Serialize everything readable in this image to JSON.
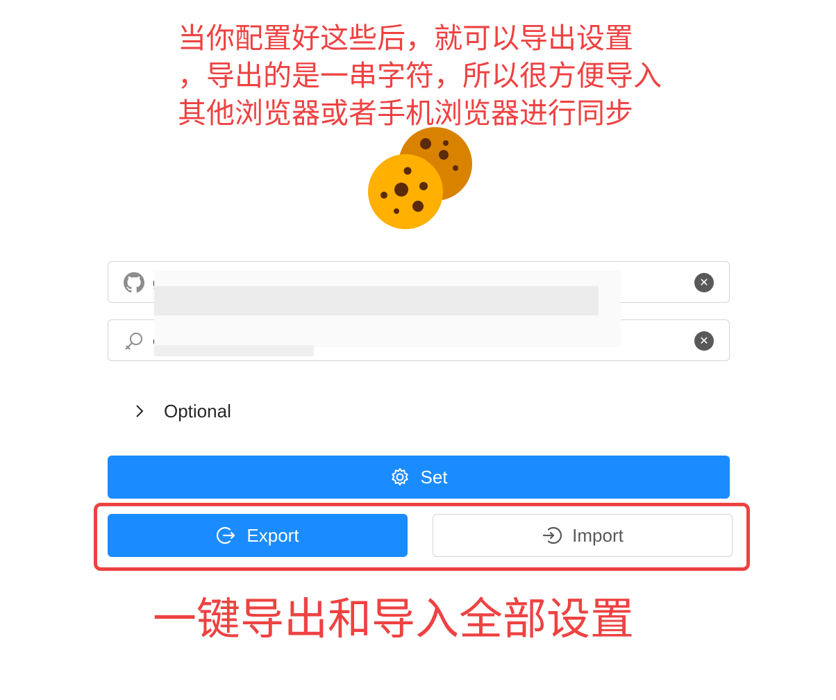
{
  "annotations": {
    "top_note": "当你配置好这些后，就可以导出设置\n，导出的是一串字符，所以很方便导入\n其他浏览器或者手机浏览器进行同步",
    "bottom_note": "一键导出和导入全部设置",
    "color": "#ee4242"
  },
  "logo": {
    "icon": "cookie-icon"
  },
  "form": {
    "token_field": {
      "icon": "github-icon",
      "value": "g",
      "clear_icon": "close-circle-icon"
    },
    "key_field": {
      "icon": "key-icon",
      "value": "c",
      "clear_icon": "close-circle-icon"
    }
  },
  "optional": {
    "label": "Optional",
    "icon": "chevron-right-icon"
  },
  "buttons": {
    "set": {
      "label": "Set",
      "icon": "gear-icon"
    },
    "export": {
      "label": "Export",
      "icon": "export-icon"
    },
    "import": {
      "label": "Import",
      "icon": "import-icon"
    }
  },
  "colors": {
    "primary": "#1a8cff",
    "annotation": "#ee4242",
    "border": "#d4d4d4"
  }
}
